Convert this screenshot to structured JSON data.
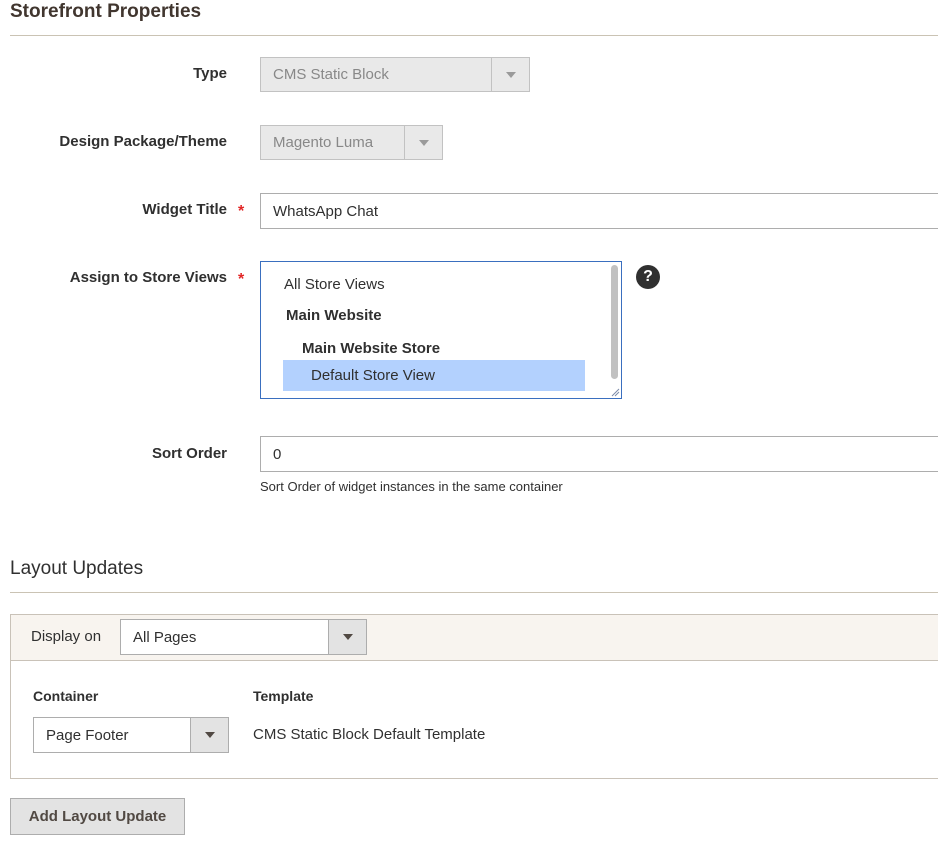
{
  "storefront": {
    "title": "Storefront Properties",
    "type": {
      "label": "Type",
      "value": "CMS Static Block"
    },
    "theme": {
      "label": "Design Package/Theme",
      "value": "Magento Luma"
    },
    "widget_title": {
      "label": "Widget Title",
      "required_mark": "*",
      "value": "WhatsApp Chat"
    },
    "store_views": {
      "label": "Assign to Store Views",
      "required_mark": "*",
      "options": [
        "All Store Views",
        "Main Website",
        "Main Website Store",
        "Default Store View"
      ],
      "selected": "Default Store View",
      "help_glyph": "?"
    },
    "sort_order": {
      "label": "Sort Order",
      "value": "0",
      "note": "Sort Order of widget instances in the same container"
    }
  },
  "layout_updates": {
    "title": "Layout Updates",
    "display_on": {
      "label": "Display on",
      "value": "All Pages"
    },
    "container": {
      "header": "Container",
      "value": "Page Footer"
    },
    "template": {
      "header": "Template",
      "value": "CMS Static Block Default Template"
    },
    "add_button": "Add Layout Update"
  },
  "colors": {
    "selected_option_bg": "#b3d1fe",
    "required_star": "#e22626",
    "panel_header_bg": "#f8f4ef",
    "button_bg": "#e3e3e3"
  },
  "icons": [
    "chevron-down-icon",
    "help-icon",
    "resize-grip-icon"
  ]
}
